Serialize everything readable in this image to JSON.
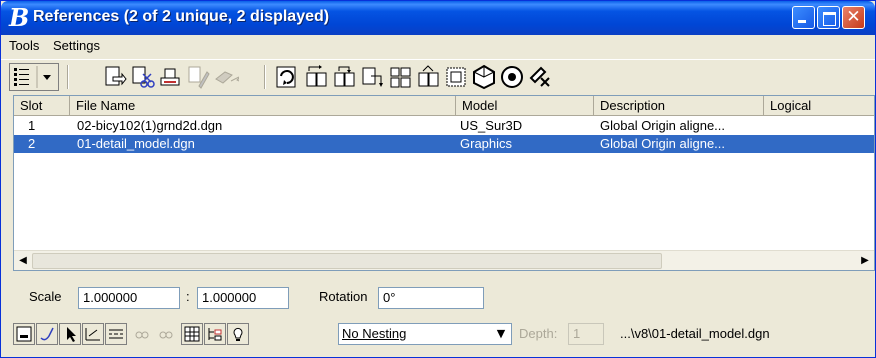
{
  "window": {
    "title": "References (2 of 2 unique, 2 displayed)"
  },
  "menu": {
    "items": [
      {
        "label": "Tools"
      },
      {
        "label": "Settings"
      }
    ]
  },
  "toolbar": {
    "tools": [
      "list-view-icon",
      "attach-reference-icon",
      "detach-reference-icon",
      "reload-icon",
      "exchange-icon",
      "move-icon",
      "copy-icon",
      "hilite-icon",
      "rotate-icon",
      "mirror-h-icon",
      "mirror-v-icon",
      "clip-boundary-icon",
      "clip-mask-icon",
      "clip-front-icon",
      "delete-clip-icon",
      "merge-icon",
      "snap-icon",
      "unload-icon"
    ]
  },
  "table": {
    "columns": [
      {
        "label": "Slot"
      },
      {
        "label": "File Name"
      },
      {
        "label": "Model"
      },
      {
        "label": "Description"
      },
      {
        "label": "Logical"
      }
    ],
    "rows": [
      {
        "slot": "1",
        "file": "02-bicy102(1)grnd2d.dgn",
        "model": "US_Sur3D",
        "description": "Global Origin aligne...",
        "logical": "",
        "selected": false
      },
      {
        "slot": "2",
        "file": "01-detail_model.dgn",
        "model": "Graphics",
        "description": "Global Origin aligne...",
        "logical": "",
        "selected": true
      }
    ]
  },
  "settings": {
    "scale_label": "Scale",
    "scale_master": "1.000000",
    "colon": ":",
    "scale_ref": "1.000000",
    "rotation_label": "Rotation",
    "rotation_value": "0°",
    "nesting_value": "No Nesting",
    "depth_label": "Depth:",
    "depth_value": "1",
    "file_path": "...\\v8\\01-detail_model.dgn"
  },
  "colors": {
    "title_bar": "#0554e3",
    "selection": "#316ac5",
    "window_bg": "#ece9d8"
  }
}
